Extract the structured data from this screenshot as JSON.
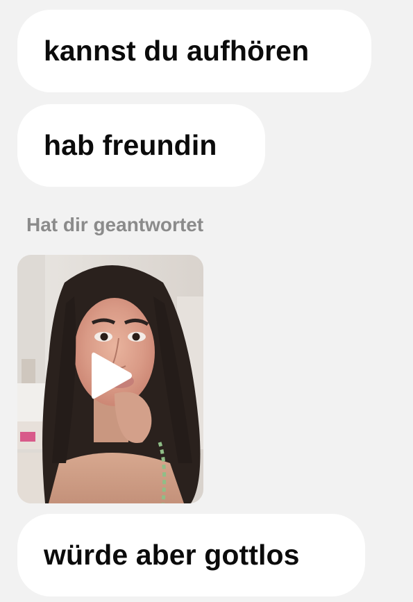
{
  "messages": [
    {
      "text": "kannst du aufhören"
    },
    {
      "text": "hab freundin"
    },
    {
      "text": "würde aber gottlos"
    }
  ],
  "reply": {
    "label": "Hat dir geantwortet",
    "media_type": "video",
    "icon": "play-icon"
  },
  "colors": {
    "background": "#f2f2f2",
    "bubble": "#ffffff",
    "text": "#0b0b0b",
    "label": "#8b8b8b"
  }
}
